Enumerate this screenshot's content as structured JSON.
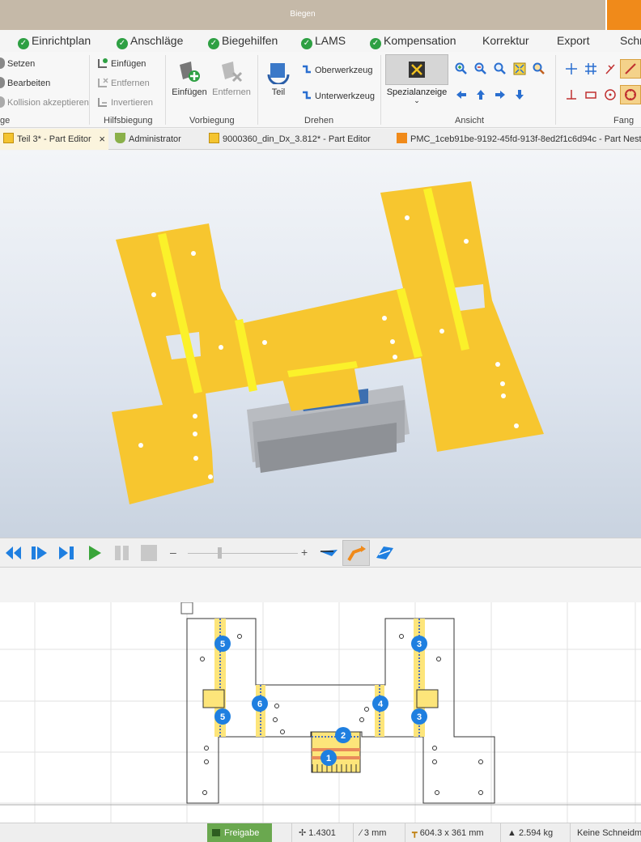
{
  "window": {
    "title": "Biegen"
  },
  "menu": {
    "items": [
      {
        "label": "Einrichtplan",
        "checked": true
      },
      {
        "label": "Anschläge",
        "checked": true
      },
      {
        "label": "Biegehilfen",
        "checked": true
      },
      {
        "label": "LAMS",
        "checked": true
      },
      {
        "label": "Kompensation",
        "checked": true
      },
      {
        "label": "Korrektur",
        "checked": false
      },
      {
        "label": "Export",
        "checked": false
      },
      {
        "label": "Schr",
        "checked": false
      }
    ]
  },
  "ribbon": {
    "group0": {
      "label": "ge",
      "items": [
        "Setzen",
        "Bearbeiten",
        "Kollision akzeptieren"
      ]
    },
    "hilfsbiegung": {
      "label": "Hilfsbiegung",
      "items": [
        "Einfügen",
        "Entfernen",
        "Invertieren"
      ]
    },
    "vorbiegung": {
      "label": "Vorbiegung",
      "insert": "Einfügen",
      "remove": "Entfernen"
    },
    "drehen": {
      "label": "Drehen",
      "part": "Teil",
      "upper": "Oberwerkzeug",
      "lower": "Unterwerkzeug"
    },
    "ansicht": {
      "label": "Ansicht",
      "special": "Spezialanzeige"
    },
    "fang": {
      "label": "Fang"
    }
  },
  "tabs": [
    {
      "label": "Teil 3* - Part Editor",
      "close": "×"
    },
    {
      "label": "Administrator"
    },
    {
      "label": "9000360_din_Dx_3.812* - Part Editor"
    },
    {
      "label": "PMC_1ceb91be-9192-45fd-913f-8ed2f1c6d94c - Part Neste"
    }
  ],
  "player": {
    "minus": "–",
    "plus": "+"
  },
  "drawing": {
    "bend_markers": [
      "5",
      "5",
      "6",
      "2",
      "1",
      "4",
      "3",
      "3"
    ]
  },
  "status": {
    "release": "Freigabe",
    "factor": "1.4301",
    "thickness": "3 mm",
    "dimensions": "604.3 x 361 mm",
    "weight": "2.594 kg",
    "cut": "Keine Schneidma"
  },
  "colors": {
    "part_fill": "#f7c62f",
    "bend_line": "#fbf12a",
    "accent": "#f08a1a",
    "marker": "#1f7fe0",
    "release_green": "#6aa84f"
  }
}
